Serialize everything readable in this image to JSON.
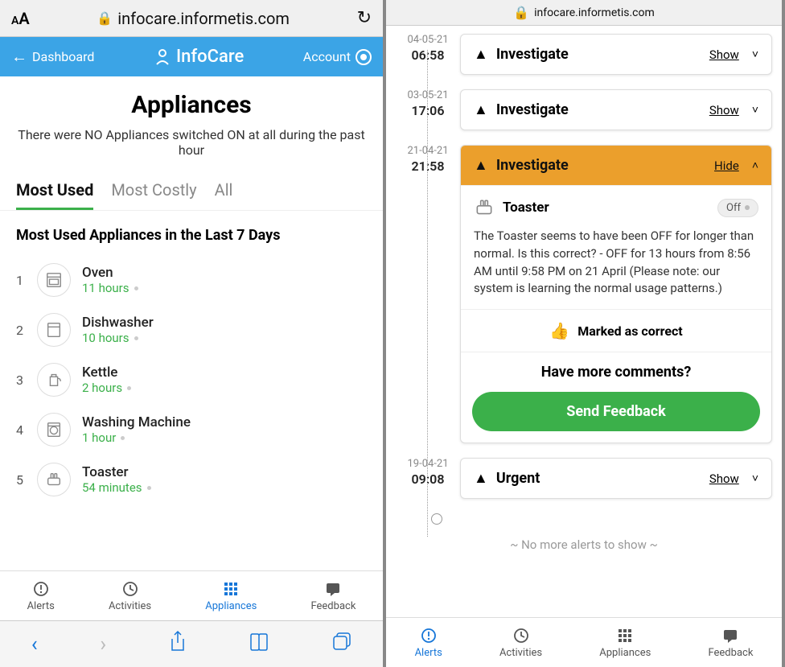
{
  "url": "infocare.informetis.com",
  "left": {
    "header": {
      "back_label": "Dashboard",
      "logo_text": "InfoCare",
      "account_label": "Account"
    },
    "page_title": "Appliances",
    "page_sub": "There were NO Appliances switched ON at all during the past hour",
    "tabs": [
      "Most Used",
      "Most Costly",
      "All"
    ],
    "active_tab": 0,
    "section_title": "Most Used Appliances in the Last 7 Days",
    "appliances": [
      {
        "rank": "1",
        "name": "Oven",
        "time": "11 hours",
        "icon": "oven"
      },
      {
        "rank": "2",
        "name": "Dishwasher",
        "time": "10 hours",
        "icon": "dishwasher"
      },
      {
        "rank": "3",
        "name": "Kettle",
        "time": "2 hours",
        "icon": "kettle"
      },
      {
        "rank": "4",
        "name": "Washing Machine",
        "time": "1 hour",
        "icon": "washer"
      },
      {
        "rank": "5",
        "name": "Toaster",
        "time": "54 minutes",
        "icon": "toaster"
      }
    ],
    "bottom_nav": [
      {
        "label": "Alerts",
        "icon": "alerts",
        "active": false
      },
      {
        "label": "Activities",
        "icon": "activities",
        "active": false
      },
      {
        "label": "Appliances",
        "icon": "appliances",
        "active": true
      },
      {
        "label": "Feedback",
        "icon": "feedback",
        "active": false
      }
    ]
  },
  "right": {
    "alerts": [
      {
        "date": "04-05-21",
        "time": "06:58",
        "title": "Investigate",
        "toggle": "Show",
        "expanded": false
      },
      {
        "date": "03-05-21",
        "time": "17:06",
        "title": "Investigate",
        "toggle": "Show",
        "expanded": false
      },
      {
        "date": "21-04-21",
        "time": "21:58",
        "title": "Investigate",
        "toggle": "Hide",
        "expanded": true,
        "device_name": "Toaster",
        "device_status": "Off",
        "description": "The Toaster seems to have been OFF for longer than normal. Is this correct? - OFF for 13 hours from 8:56 AM until 9:58 PM on 21 April (Please note: our system is learning the normal usage patterns.)",
        "marked_text": "Marked as correct",
        "comments_q": "Have more comments?",
        "send_label": "Send Feedback"
      },
      {
        "date": "19-04-21",
        "time": "09:08",
        "title": "Urgent",
        "toggle": "Show",
        "expanded": false
      }
    ],
    "no_more": "~ No more alerts to show ~",
    "bottom_nav": [
      {
        "label": "Alerts",
        "icon": "alerts",
        "active": true
      },
      {
        "label": "Activities",
        "icon": "activities",
        "active": false
      },
      {
        "label": "Appliances",
        "icon": "appliances",
        "active": false
      },
      {
        "label": "Feedback",
        "icon": "feedback",
        "active": false
      }
    ]
  }
}
